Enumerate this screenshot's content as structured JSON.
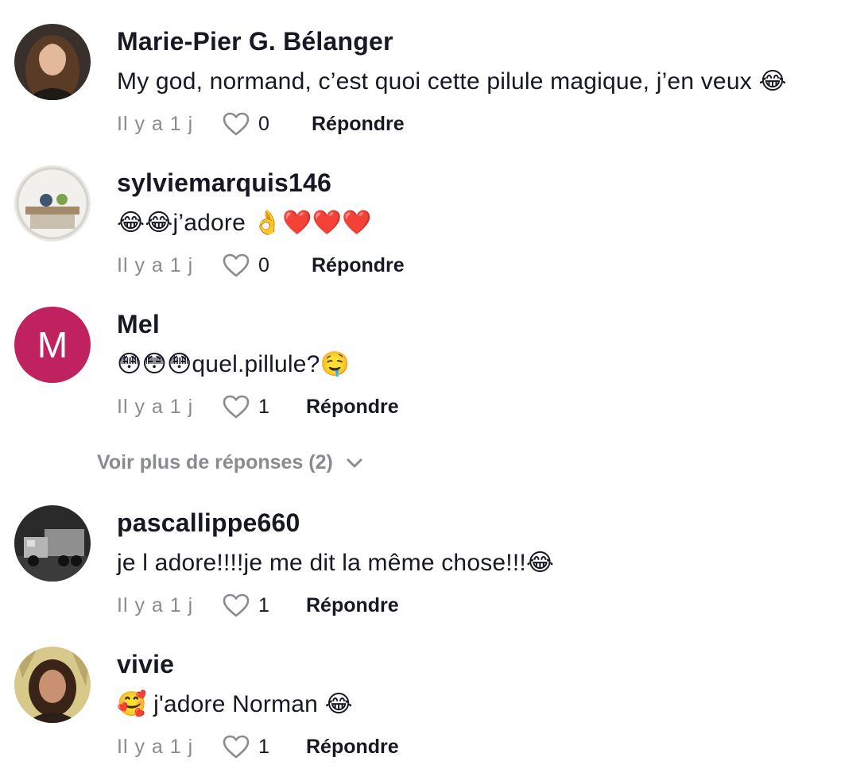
{
  "comments": [
    {
      "username": "Marie-Pier G. Bélanger",
      "text": "My god, normand, c’est quoi cette pilule magique, j’en veux 😂",
      "time": "Il y a 1 j",
      "likes": "0",
      "reply_label": "Répondre",
      "avatar": "photo"
    },
    {
      "username": "sylviemarquis146",
      "text": "😂😂j’adore 👌❤️❤️❤️",
      "time": "Il y a 1 j",
      "likes": "0",
      "reply_label": "Répondre",
      "avatar": "photo"
    },
    {
      "username": "Mel",
      "text": "😳😳😳quel.pillule?🤤",
      "time": "Il y a 1 j",
      "likes": "1",
      "reply_label": "Répondre",
      "avatar": "initial",
      "avatar_initial": "M",
      "avatar_color": "#c0225f"
    },
    {
      "username": "pascallippe660",
      "text": "je l adore!!!!je me dit la même chose!!!😂",
      "time": "Il y a 1 j",
      "likes": "1",
      "reply_label": "Répondre",
      "avatar": "photo"
    },
    {
      "username": "vivie",
      "text": "🥰 j'adore Norman 😂",
      "time": "Il y a 1 j",
      "likes": "1",
      "reply_label": "Répondre",
      "avatar": "photo"
    }
  ],
  "view_more_label": "Voir plus de réponses (2)",
  "icons": {
    "like": "heart-outline-icon",
    "expand": "chevron-down-icon"
  },
  "colors": {
    "text": "#161823",
    "secondary": "#8a8b91"
  }
}
